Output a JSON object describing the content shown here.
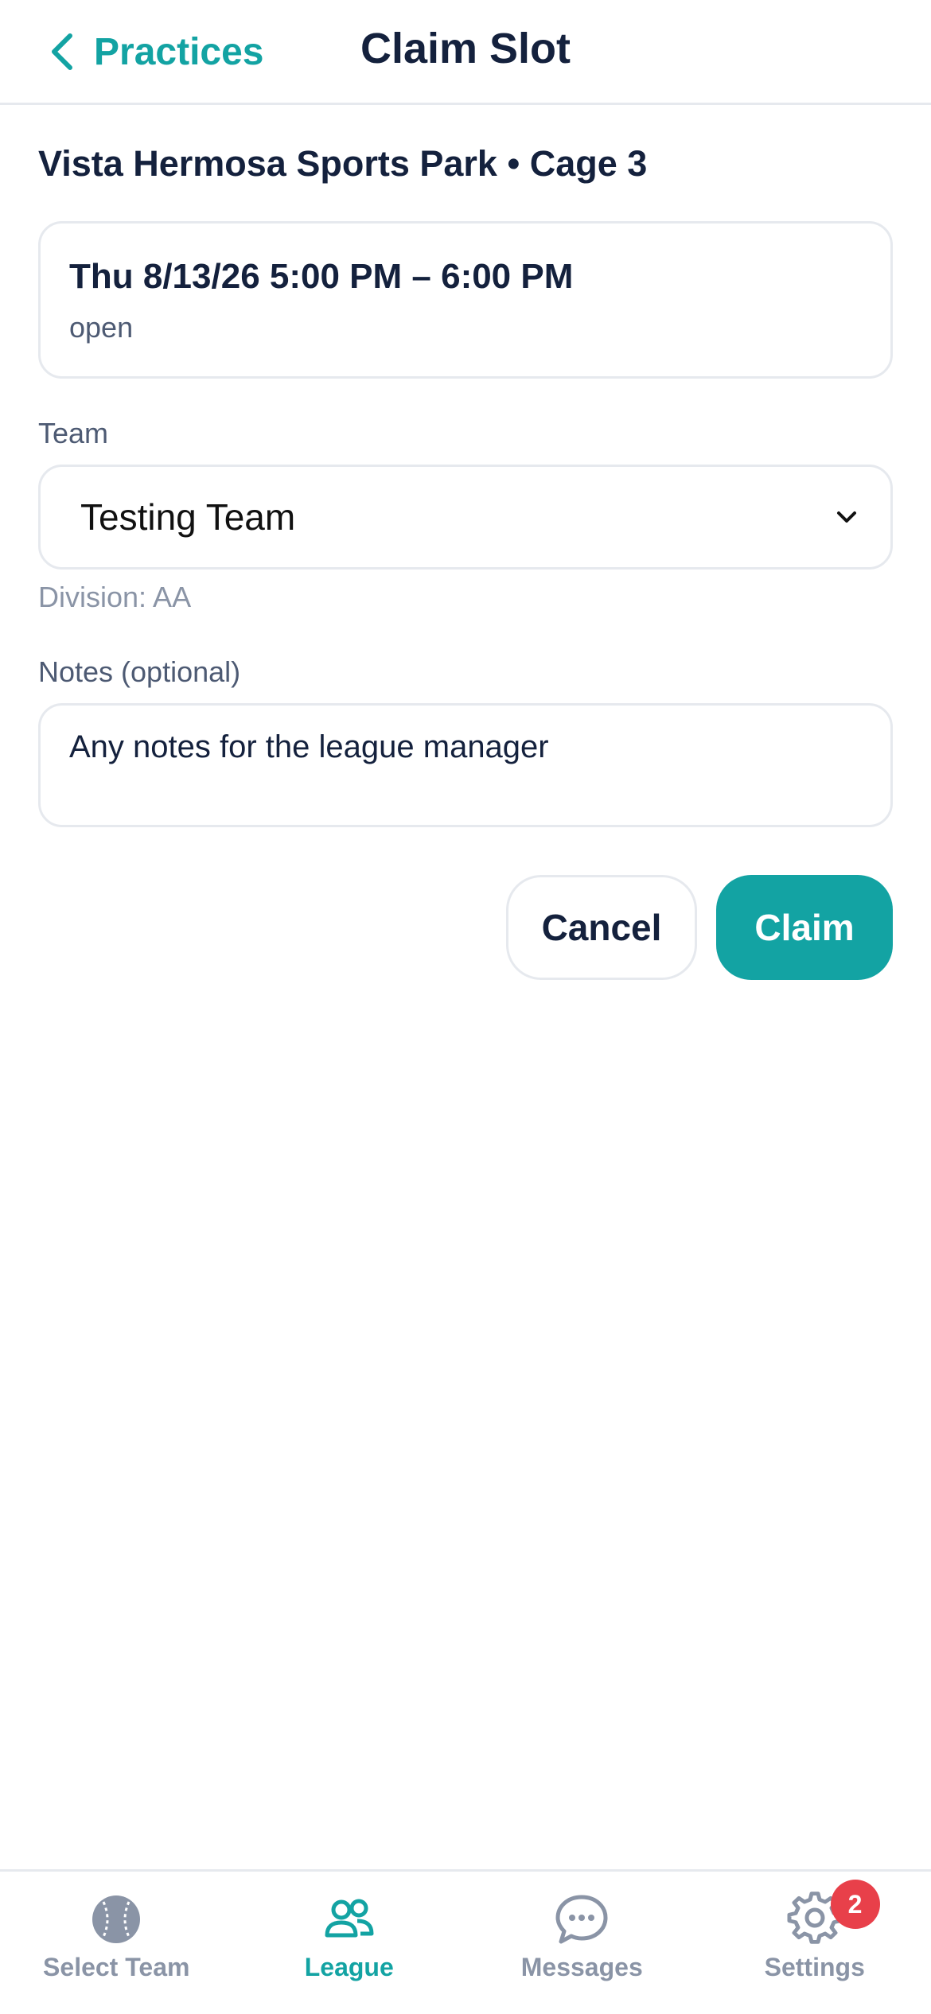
{
  "header": {
    "back_label": "Practices",
    "title": "Claim Slot"
  },
  "slot": {
    "facility": "Vista Hermosa Sports Park • Cage 3",
    "time": "Thu 8/13/26 5:00 PM – 6:00 PM",
    "status": "open"
  },
  "team_field": {
    "label": "Team",
    "selected": "Testing Team",
    "division": "Division: AA"
  },
  "notes_field": {
    "label": "Notes (optional)",
    "placeholder": "Any notes for the league manager",
    "value": ""
  },
  "actions": {
    "cancel_label": "Cancel",
    "claim_label": "Claim"
  },
  "tabbar": {
    "items": [
      {
        "label": "Select Team",
        "icon": "baseball-icon",
        "active": false
      },
      {
        "label": "League",
        "icon": "users-icon",
        "active": true
      },
      {
        "label": "Messages",
        "icon": "chat-bubble-icon",
        "active": false
      },
      {
        "label": "Settings",
        "icon": "gear-icon",
        "active": false,
        "badge": "2"
      }
    ]
  },
  "colors": {
    "accent": "#13a3a3",
    "text": "#14213d",
    "muted": "#8a94a6",
    "badge": "#e8404a"
  }
}
